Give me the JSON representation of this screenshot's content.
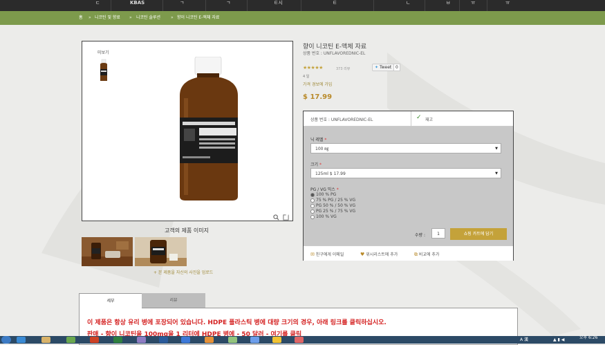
{
  "top_nav": {
    "items": [
      "ㄷ",
      "KBAS",
      "ㄱ",
      "ㄱ",
      "ㅌ시",
      "ㅌ",
      "ㄴ",
      "ㅂ",
      "ㅠ",
      "ㅠ"
    ]
  },
  "breadcrumb": {
    "items": [
      "홈",
      "니코틴 및 향료",
      "니코틴 솔루션",
      "향이 니코틴 E-액체 자료"
    ],
    "separator": "»"
  },
  "product": {
    "title": "향이 니코틴 E-액체 자료",
    "sku_line": "상품 번호 : UNFLAVOREDNIC-EL",
    "stars": "★★★★★",
    "review_count": "373 리뷰",
    "tweet_label": "Tweet",
    "tweet_count": "0",
    "stock_note": "4 일",
    "price_alert": "가격 경보에 가입",
    "price": "$ 17.99",
    "preview_label": "미보기",
    "customer_images_title": "고객의 제품 이미지",
    "upload_link": "+ 본 제품을 자신의 사진을 업로드"
  },
  "options": {
    "sku": "상품 번호 : UNFLAVOREDNIC-EL",
    "in_stock": "재고",
    "nic_label": "닉 레벨",
    "nic_value": "100 ㎎",
    "size_label": "크기",
    "size_value": "125ml $ 17.99",
    "pgvg_label": "PG / VG 믹스",
    "pgvg_options": [
      "100 % PG",
      "75 % PG / 25 % VG",
      "PG 50 % / 50 % VG",
      "PG 25 % / 75 % VG",
      "100 % VG"
    ],
    "pgvg_selected": 0,
    "qty_label": "수량 :",
    "qty_value": "1",
    "cart_button": "쇼핑 카트에 담기",
    "email_friend": "친구에게 이메일",
    "wishlist": "위시리스트에 추가",
    "compare": "비교에 추가"
  },
  "tabs": {
    "detail": "세부",
    "review": "리뷰"
  },
  "description": {
    "line1": "이 제품은 항상 유리 병에 포장되어 있습니다. HDPE 플라스틱 병에 대량 크기의 경우, 아래 링크를 클릭하십시오.",
    "line2": "판매 - 향이 니코틴을 100mg을 1 리터에 HDPE 병에 - 50 달러 - 여기를 클릭"
  },
  "taskbar": {
    "clock": "오후 6:26",
    "tray_lang": "A 漢"
  },
  "colors": {
    "accent_gold": "#c4a23a",
    "breadcrumb_green": "#7d9a4c",
    "description_red": "#d42020"
  }
}
